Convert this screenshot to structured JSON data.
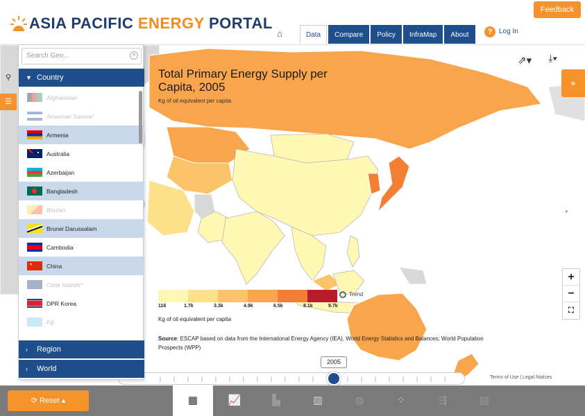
{
  "header": {
    "logo": "ASIA PACIFIC ENERGY PORTAL",
    "logo_parts": [
      "ASIA PACIFIC ",
      "ENERGY",
      " PORTAL"
    ],
    "feedback": "Feedback",
    "tabs": [
      {
        "label": "Data",
        "active": true
      },
      {
        "label": "Compare",
        "active": false
      },
      {
        "label": "Policy",
        "active": false
      },
      {
        "label": "InfraMap",
        "active": false
      },
      {
        "label": "About",
        "active": false
      }
    ],
    "login": "Log In"
  },
  "map": {
    "title": "Total Primary Energy Supply per Capita, 2005",
    "subtitle": "Kg of oil equivalent per capita",
    "legend": {
      "ticks": [
        "116",
        "1.7k",
        "3.3k",
        "4.9k",
        "6.5k",
        "8.1k",
        "9.7k"
      ],
      "colors": [
        "#fff7b4",
        "#fde08a",
        "#fcc468",
        "#f9a54c",
        "#f27f34",
        "#e14e2a",
        "#b81c2c"
      ],
      "unit": "Kg of oil equivalent per capita"
    },
    "trend": "Trend",
    "source_label": "Source",
    "source_text": ": ESCAP based on data from the International Energy Agency (IEA), World Energy Statistics and Balances; World Population Prospects (WPP)",
    "year": "2005",
    "terms": "Terms of Use",
    "legal": "Legal Notices",
    "separator": "|"
  },
  "panel": {
    "search_placeholder": "Search Geo...",
    "country_header": "Country",
    "region_header": "Region",
    "world_header": "World",
    "countries": [
      {
        "name": "Afghanistan",
        "state": "disabled"
      },
      {
        "name": "American Samoa*",
        "state": "disabled"
      },
      {
        "name": "Armenia",
        "state": "selected"
      },
      {
        "name": "Australia",
        "state": "normal"
      },
      {
        "name": "Azerbaijan",
        "state": "normal"
      },
      {
        "name": "Bangladesh",
        "state": "selected"
      },
      {
        "name": "Bhutan",
        "state": "disabled"
      },
      {
        "name": "Brunei Darussalam",
        "state": "selected"
      },
      {
        "name": "Cambodia",
        "state": "normal"
      },
      {
        "name": "China",
        "state": "selected"
      },
      {
        "name": "Cook Islands*",
        "state": "disabled"
      },
      {
        "name": "DPR Korea",
        "state": "normal"
      },
      {
        "name": "Fiji",
        "state": "disabled"
      }
    ]
  },
  "bottom": {
    "reset": "Reset"
  },
  "colors": {
    "accent": "#f5922a",
    "brand": "#1f4e8c",
    "selected_row": "#c8d8ea"
  }
}
